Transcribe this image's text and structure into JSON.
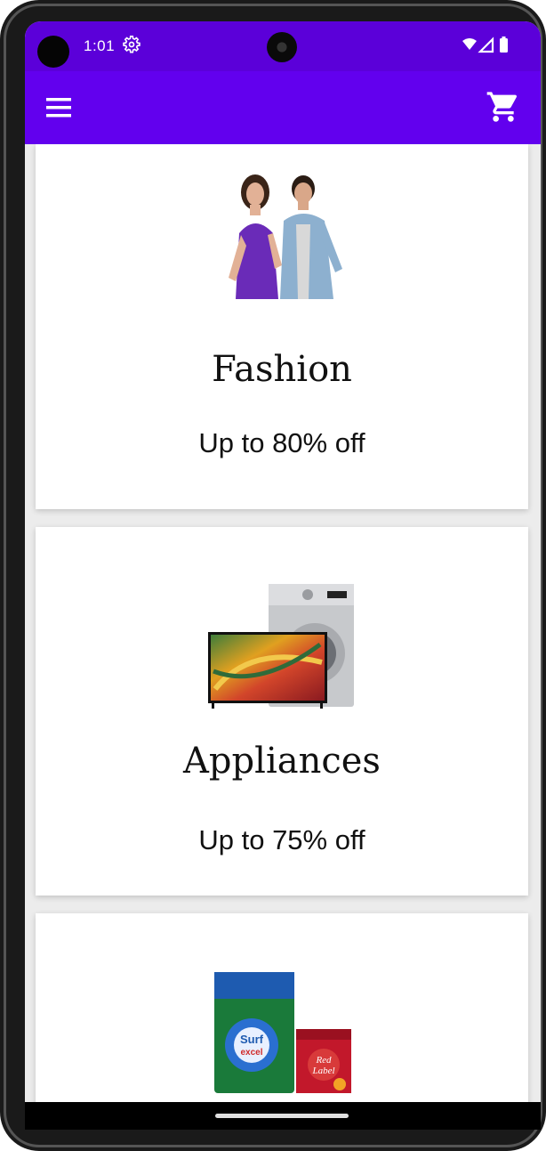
{
  "status_bar": {
    "time": "1:01",
    "icons": [
      "settings-icon",
      "wifi-icon",
      "signal-icon",
      "battery-icon"
    ]
  },
  "app_bar": {
    "icons": [
      "menu-icon",
      "cart-icon"
    ],
    "color": "#6200ee"
  },
  "categories": [
    {
      "title": "Fashion",
      "subtitle": "Up to 80% off",
      "image": "fashion-models-image"
    },
    {
      "title": "Appliances",
      "subtitle": "Up to 75% off",
      "image": "tv-washing-machine-image"
    },
    {
      "title": "",
      "subtitle": "",
      "image": "grocery-products-image"
    }
  ],
  "colors": {
    "status_bar": "#5b00d9",
    "app_bar": "#6200ee",
    "card_background": "#ffffff",
    "page_background": "#ececec"
  }
}
